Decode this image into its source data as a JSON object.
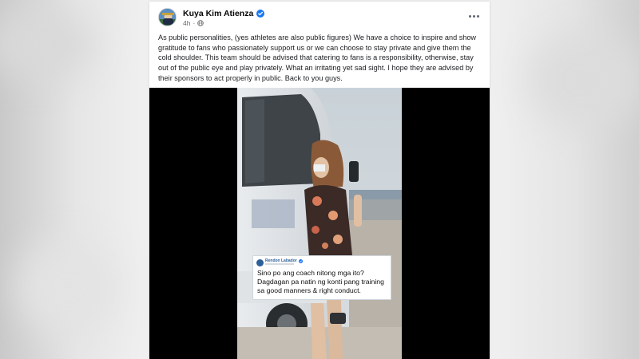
{
  "post": {
    "author": "Kuya Kim Atienza",
    "time": "4h",
    "text": "As public personalities, (yes athletes are also public figures) We have a choice to inspire and show gratitude to fans who passionately support us or we can choose to stay private and give them the cold shoulder. This team should be advised that catering to fans is a responsibility, otherwise, stay out of the public eye and play privately. What an irritating yet sad sight. I hope they are advised by their sponsors to act properly in public. Back to you guys."
  },
  "media": {
    "overlay": {
      "name": "Rendon Labador",
      "text": "Sino po ang coach nitong mga ito? Dagdagan pa natin ng konti pang training sa good manners & right conduct."
    }
  },
  "icons": {
    "verified": "verified-badge-icon",
    "audience": "globe-icon",
    "more": "more-options-icon"
  },
  "colors": {
    "accent": "#1877f2",
    "name_text": "#050505",
    "meta_text": "#65676b",
    "overlay_name": "#2b5f99"
  }
}
